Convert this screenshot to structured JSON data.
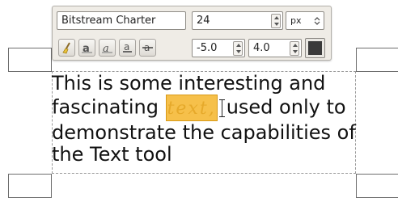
{
  "toolbar": {
    "font_name": "Bitstream Charter",
    "font_size": "24",
    "unit": "px",
    "letter_spacing": "-5.0",
    "line_spacing": "4.0",
    "text_color": "#3a3a3a",
    "icons": [
      "clear-style-icon",
      "bold-style-icon",
      "italic-style-icon",
      "underline-style-icon",
      "strikethrough-style-icon"
    ]
  },
  "canvas": {
    "line1": "This is some interesting and",
    "line2_before": "fascinating ",
    "highlighted_word": "text,",
    "line2_after": "used only to",
    "line3": "demonstrate the capabilities of",
    "line4": "the Text tool",
    "highlight_color": "#f6c04a"
  }
}
